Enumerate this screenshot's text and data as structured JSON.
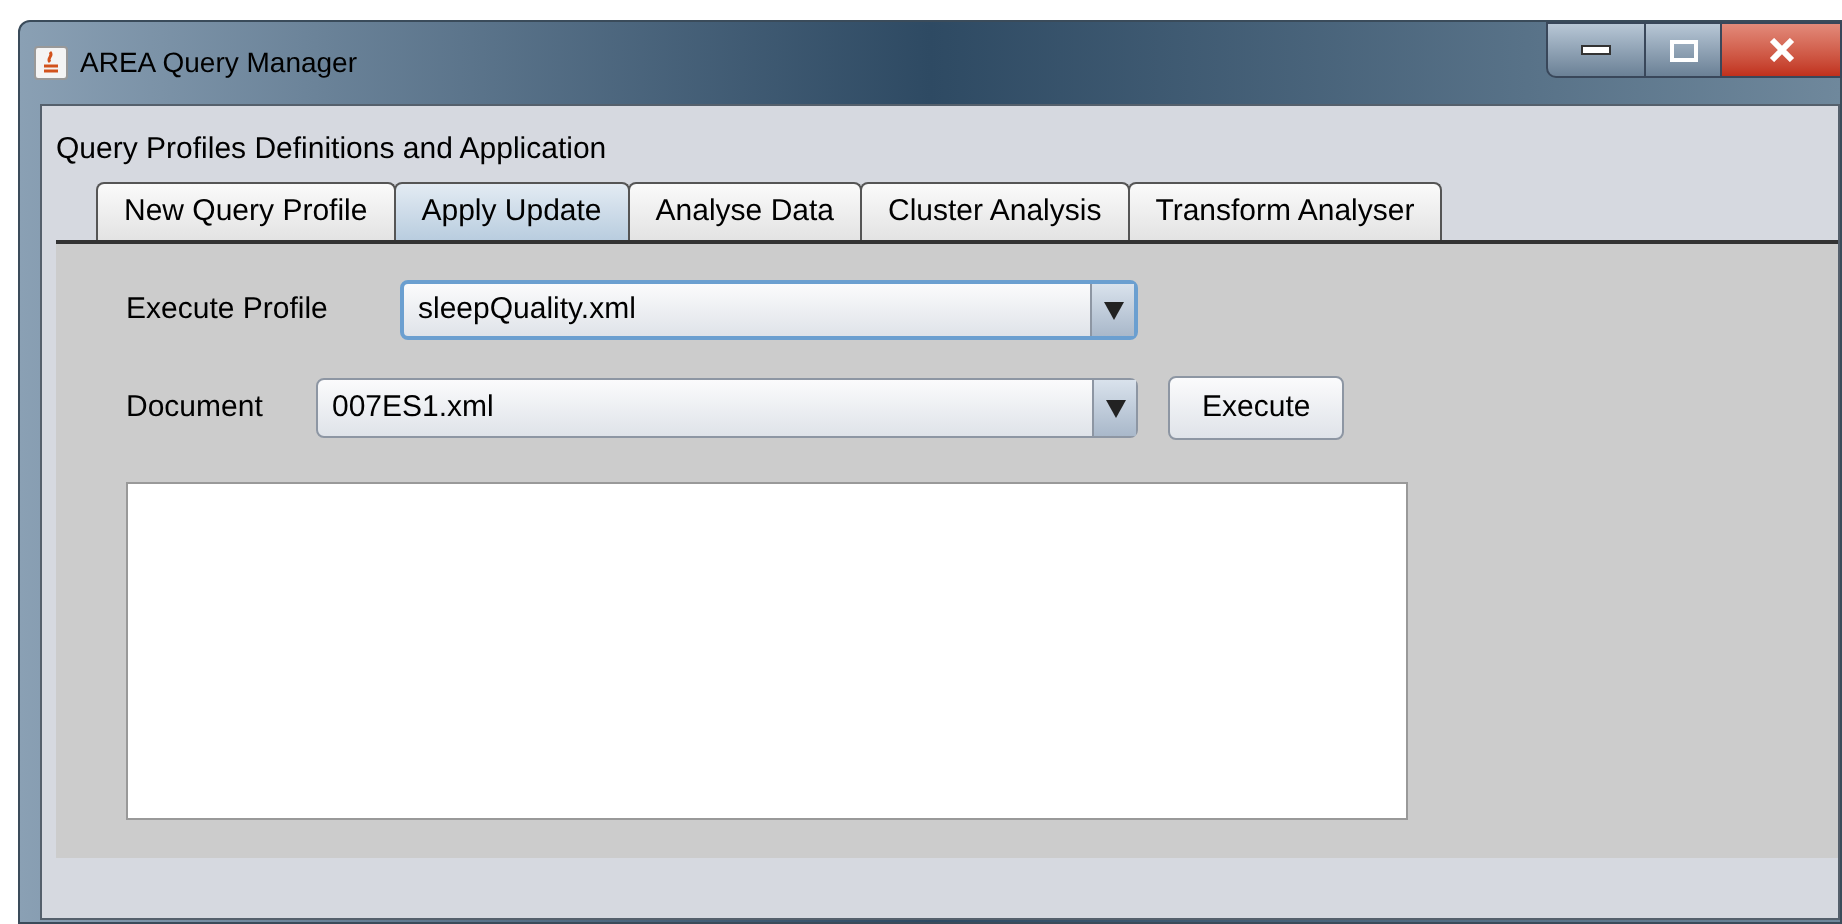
{
  "window": {
    "title": "AREA Query Manager"
  },
  "heading": "Query Profiles Definitions and Application",
  "tabs": [
    {
      "label": "New Query Profile",
      "selected": false
    },
    {
      "label": "Apply Update",
      "selected": true
    },
    {
      "label": "Analyse Data",
      "selected": false
    },
    {
      "label": "Cluster Analysis",
      "selected": false
    },
    {
      "label": "Transform Analyser",
      "selected": false
    }
  ],
  "execute_profile": {
    "label": "Execute Profile",
    "value": "sleepQuality.xml",
    "focused": true
  },
  "document": {
    "label": "Document",
    "value": "007ES1.xml",
    "focused": false
  },
  "execute_button": "Execute"
}
